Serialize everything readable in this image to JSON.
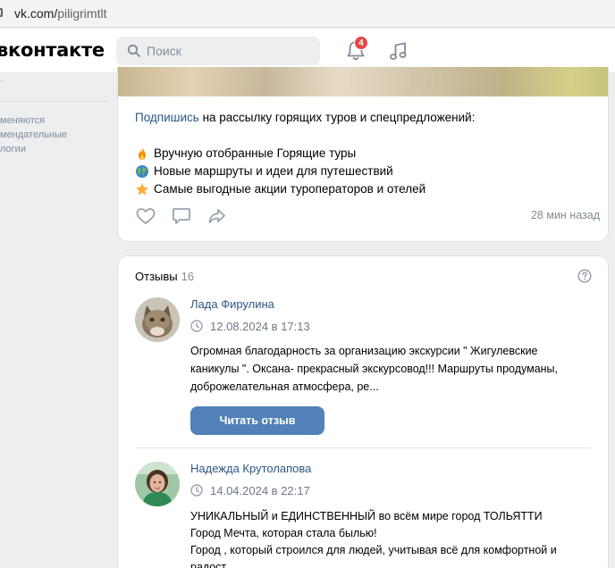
{
  "browser": {
    "url_host": "vk.com/",
    "url_path": "piligrimtlt"
  },
  "header": {
    "logo": "вконтакте",
    "search_placeholder": "Поиск",
    "notifications_count": "4"
  },
  "left_column": {
    "mark": "·",
    "note_lines": [
      "меняются",
      "мендательные",
      "логии"
    ]
  },
  "post": {
    "link_text": "Подпишись",
    "intro_rest": " на рассылку горящих туров и спецпредложений:",
    "bullets": [
      {
        "icon": "fire-emoji",
        "text": "Вручную отобранные Горящие туры"
      },
      {
        "icon": "globe-emoji",
        "text": "Новые маршруты и идеи для путешествий"
      },
      {
        "icon": "star-emoji",
        "text": "Самые выгодные акции туроператоров и отелей"
      }
    ],
    "time": "28 мин назад"
  },
  "reviews": {
    "title": "Отзывы",
    "count": "16",
    "items": [
      {
        "name": "Лада Фирулина",
        "date": "12.08.2024 в 17:13",
        "lines": [
          "Огромная благодарность за организацию экскурсии \" Жигулевские",
          "каникулы \". Оксана- прекрасный экскурсовод!!! Маршруты продуманы,",
          "доброжелательная атмосфера, ре..."
        ],
        "button": "Читать отзыв"
      },
      {
        "name": "Надежда Крутолапова",
        "date": "14.04.2024 в 22:17",
        "lines": [
          "УНИКАЛЬНЫЙ и ЕДИНСТВЕННЫЙ во всём мире город ТОЛЬЯТТИ",
          "Город Мечта, которая стала былью!",
          "Город , который строился для людей, учитывая всё для комфортной и",
          "радост..."
        ]
      }
    ]
  },
  "colors": {
    "accent": "#5181b8",
    "link": "#2a5885",
    "badge": "#e64646",
    "background": "#edeef0"
  }
}
